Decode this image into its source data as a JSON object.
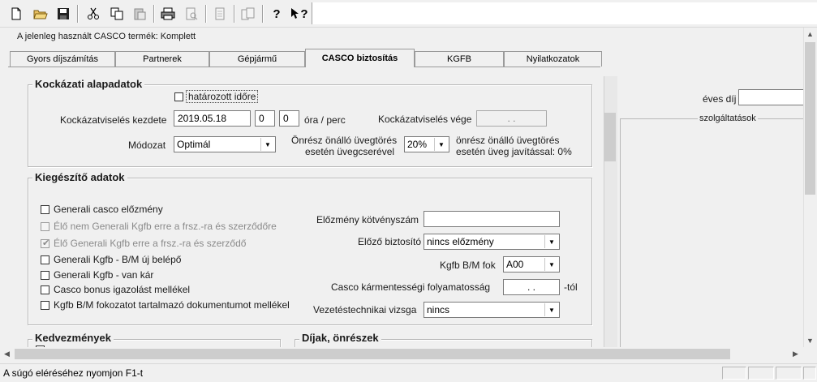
{
  "toolbar": {
    "buttons": [
      "new-document-icon",
      "open-folder-icon",
      "save-icon",
      "cut-icon",
      "copy-icon",
      "paste-icon",
      "print-icon",
      "print-preview-icon",
      "page-icon",
      "pages-icon",
      "help-icon",
      "context-help-icon"
    ],
    "help_glyph": "?",
    "context_help_glyph": "?"
  },
  "header": {
    "product_text": "A jelenleg használt CASCO termék: Komplett"
  },
  "tabs": [
    {
      "label": "Gyors díjszámítás"
    },
    {
      "label": "Partnerek"
    },
    {
      "label": "Gépjármű"
    },
    {
      "label": "CASCO biztosítás",
      "active": true
    },
    {
      "label": "KGFB"
    },
    {
      "label": "Nyilatkozatok"
    }
  ],
  "kockazati": {
    "title": "Kockázati alapadatok",
    "hatarozott_label": "határozott időre",
    "kezdete_label": "Kockázatviselés kezdete",
    "kezdete_value": "2019.05.18",
    "ora_value": "0",
    "perc_value": "0",
    "ora_perc_label": "óra / perc",
    "vege_label": "Kockázatviselés vége",
    "vege_value": ". .",
    "modozat_label": "Módozat",
    "modozat_value": "Optimál",
    "onresz_cserevel_label_1": "Önrész önálló üvegtörés",
    "onresz_cserevel_label_2": "esetén üvegcserével",
    "onresz_value": "20%",
    "onresz_javitassal_label_1": "önrész önálló üvegtörés",
    "onresz_javitassal_label_2": "esetén üveg javítással: 0%"
  },
  "kiegeszito": {
    "title": "Kiegészítő adatok",
    "checkboxes": [
      {
        "label": "Generali casco előzmény",
        "disabled": false,
        "checked": false
      },
      {
        "label": "Élő nem Generali Kgfb erre a frsz.-ra és szerződőre",
        "disabled": true,
        "checked": false
      },
      {
        "label": "Élő Generali Kgfb erre a frsz.-ra és szerződő",
        "disabled": true,
        "checked": true
      },
      {
        "label": "Generali Kgfb - B/M új belépő",
        "disabled": false,
        "checked": false
      },
      {
        "label": "Generali Kgfb - van kár",
        "disabled": false,
        "checked": false
      },
      {
        "label": "Casco bonus igazolást mellékel",
        "disabled": false,
        "checked": false
      },
      {
        "label": "Kgfb B/M fokozatot tartalmazó dokumentumot mellékel",
        "disabled": false,
        "checked": false
      }
    ],
    "elozmeny_kotveny_label": "Előzmény kötvényszám",
    "elozmeny_kotveny_value": "",
    "elozo_biztosito_label": "Előző biztosító",
    "elozo_biztosito_value": "nincs előzmény",
    "kgfb_bm_label": "Kgfb B/M fok",
    "kgfb_bm_value": "A00",
    "karmentes_label": "Casco kármentességi folyamatosság",
    "karmentes_value": ". .",
    "karmentes_suffix": "-tól",
    "vezetes_label": "Vezetéstechnikai vizsga",
    "vezetes_value": "nincs"
  },
  "kedvezmenyek": {
    "title": "Kedvezmények"
  },
  "dijak": {
    "title": "Díjak, önrészek"
  },
  "right_panel": {
    "eves_dij_label": "éves díj",
    "eves_dij_value": "",
    "szolgaltatasok_label": "szolgáltatások"
  },
  "statusbar": {
    "text": "A súgó eléréséhez nyomjon F1-t"
  },
  "scroll_arrows": {
    "up": "▲",
    "down": "▼",
    "left": "◀",
    "right": "▶"
  }
}
